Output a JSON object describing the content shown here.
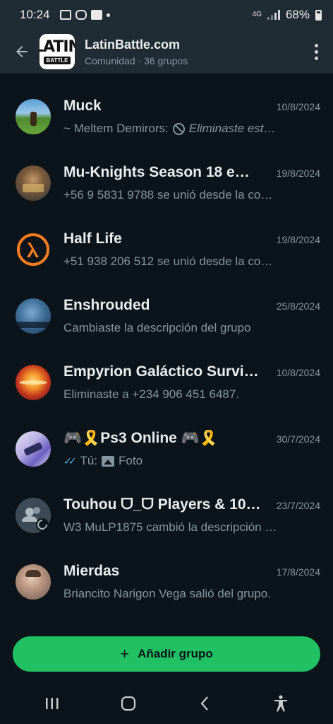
{
  "status": {
    "time": "10:24",
    "network": "4G",
    "battery": "68%"
  },
  "header": {
    "logo_line1": "LATIN",
    "logo_line2": "BATTLE",
    "title": "LatinBattle.com",
    "subtitle": "Comunidad · 36 grupos"
  },
  "groups": [
    {
      "name": "Muck",
      "time": "10/8/2024",
      "message_prefix": "~ Meltem Demirors:",
      "message": "Eliminaste est…"
    },
    {
      "name": "Mu-Knights Season 18 e…",
      "time": "19/8/2024",
      "message": "+56 9 5831 9788 se unió desde la co…"
    },
    {
      "name": "Half Life",
      "time": "19/8/2024",
      "message": "+51 938 206 512 se unió desde la co…"
    },
    {
      "name": "Enshrouded",
      "time": "25/8/2024",
      "message": "Cambiaste la descripción del grupo"
    },
    {
      "name": "Empyrion Galáctico Survi…",
      "time": "10/8/2024",
      "message": "Eliminaste a +234 906 451 6487."
    },
    {
      "name": "🎮🎗️Ps3 Online 🎮🎗️",
      "time": "30/7/2024",
      "message_prefix": "Tú:",
      "message": "Foto"
    },
    {
      "name": "Touhou ᗜ_ᗜ Players & 10…",
      "time": "23/7/2024",
      "message": "W3 MuLP1875 cambió la descripción …"
    },
    {
      "name": "Mierdas",
      "time": "17/8/2024",
      "message": "Briancito Narigon Vega salió del grupo."
    }
  ],
  "add_button": {
    "label": "Añadir grupo"
  },
  "colors": {
    "background": "#0b141a",
    "header": "#1f2c34",
    "accent": "#21c063",
    "read_ticks": "#53bdeb"
  }
}
